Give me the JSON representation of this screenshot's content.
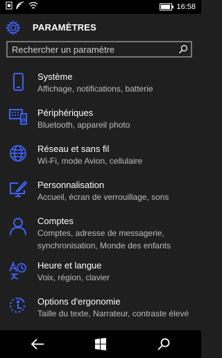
{
  "status_bar": {
    "time": "16:58"
  },
  "header": {
    "title": "PARAMÈTRES"
  },
  "search": {
    "placeholder": "Rechercher un paramètre",
    "value": ""
  },
  "accent_color": "#3d62f5",
  "items": [
    {
      "name": "Système",
      "desc": "Affichage, notifications, batterie",
      "icon": "phone-icon"
    },
    {
      "name": "Périphériques",
      "desc": "Bluetooth, appareil photo",
      "icon": "devices-icon"
    },
    {
      "name": "Réseau et sans fil",
      "desc": "Wi-Fi, mode Avion, cellulaire",
      "icon": "globe-icon"
    },
    {
      "name": "Personnalisation",
      "desc": "Accueil, écran de verrouillage, sons",
      "icon": "personalization-icon"
    },
    {
      "name": "Comptes",
      "desc": "Comptes, adresse de messagerie, synchronisation, Monde des enfants",
      "icon": "person-icon"
    },
    {
      "name": "Heure et langue",
      "desc": "Voix, région, clavier",
      "icon": "time-language-icon"
    },
    {
      "name": "Options d'ergonomie",
      "desc": "Taille du texte, Narrateur, contraste élevé",
      "icon": "ease-of-access-icon"
    }
  ]
}
